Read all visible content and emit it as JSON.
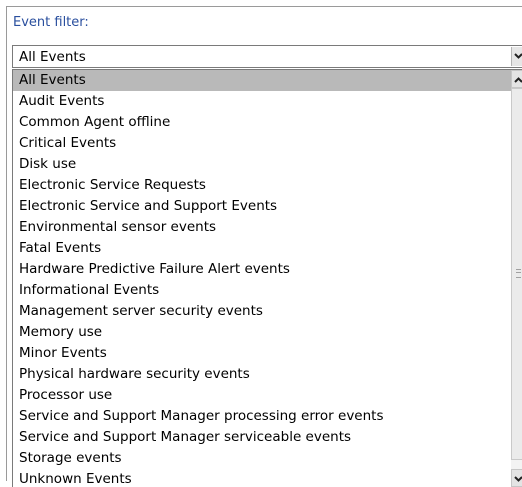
{
  "filter": {
    "label": "Event filter:",
    "selected_value": "All Events"
  },
  "list": {
    "selected_index": 0,
    "items": [
      "All Events",
      "Audit Events",
      "Common Agent offline",
      "Critical Events",
      "Disk use",
      "Electronic Service Requests",
      "Electronic Service and Support Events",
      "Environmental sensor events",
      "Fatal Events",
      "Hardware Predictive Failure Alert events",
      "Informational Events",
      "Management server security events",
      "Memory use",
      "Minor Events",
      "Physical hardware security events",
      "Processor use",
      "Service and Support Manager processing error events",
      "Service and Support Manager serviceable events",
      "Storage events",
      "Unknown Events"
    ]
  },
  "icons": {
    "dropdown": "chevron-down-icon",
    "scroll_up": "chevron-up-icon",
    "scroll_down": "chevron-down-icon",
    "grip": "scroll-grip-icon"
  },
  "colors": {
    "label": "#2a4f9e",
    "selected_row": "#b9b9b9"
  }
}
